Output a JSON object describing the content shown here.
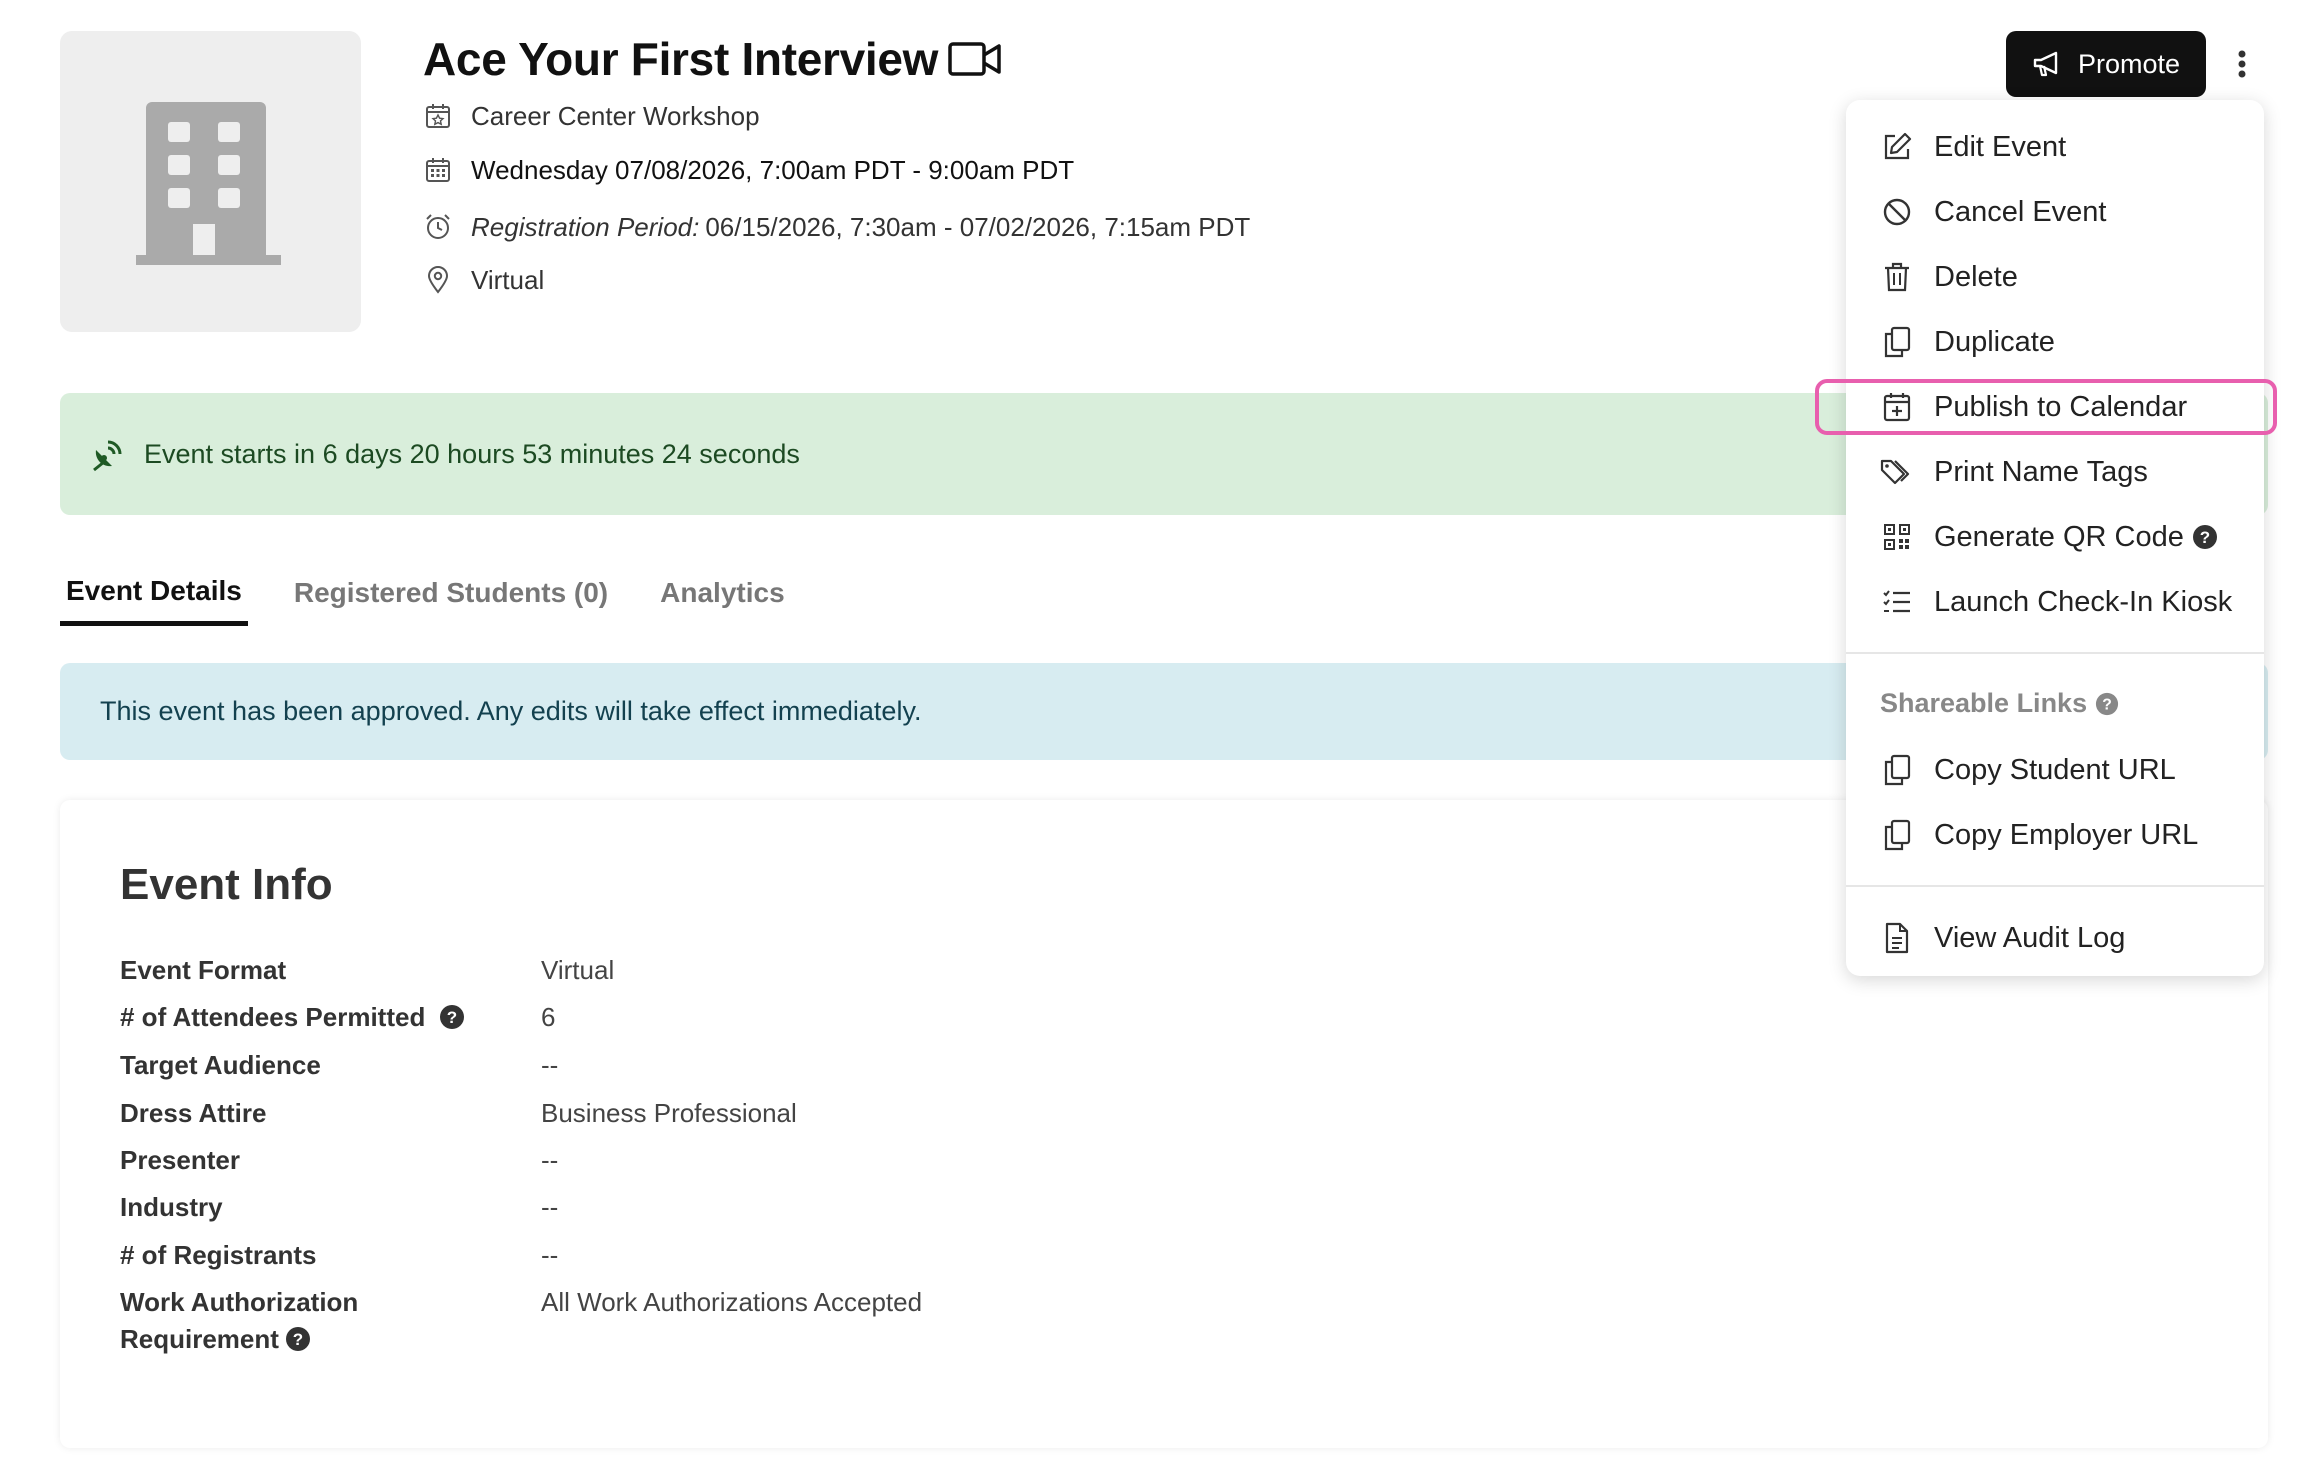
{
  "event": {
    "title": "Ace Your First Interview",
    "category": "Career Center Workshop",
    "datetime": "Wednesday 07/08/2026, 7:00am PDT - 9:00am PDT",
    "registration_label": "Registration Period:",
    "registration_value": "06/15/2026, 7:30am - 07/02/2026, 7:15am PDT",
    "location": "Virtual"
  },
  "header": {
    "promote_label": "Promote"
  },
  "countdown": {
    "text": "Event starts in 6 days 20 hours 53 minutes 24 seconds"
  },
  "tabs": [
    {
      "label": "Event Details",
      "active": true
    },
    {
      "label": "Registered Students (0)",
      "active": false
    },
    {
      "label": "Analytics",
      "active": false
    }
  ],
  "notice": {
    "text": "This event has been approved. Any edits will take effect immediately."
  },
  "info": {
    "title": "Event Info",
    "rows": [
      {
        "label": "Event Format",
        "value": "Virtual"
      },
      {
        "label": "# of Attendees Permitted",
        "value": "6"
      },
      {
        "label": "Target Audience",
        "value": "--"
      },
      {
        "label": "Dress Attire",
        "value": "Business Professional"
      },
      {
        "label": "Presenter",
        "value": "--"
      },
      {
        "label": "Industry",
        "value": "--"
      },
      {
        "label": "# of Registrants",
        "value": "--"
      },
      {
        "label": "Work Authorization",
        "label2": "Requirement",
        "value": "All Work Authorizations Accepted"
      }
    ]
  },
  "menu": {
    "items": [
      {
        "label": "Edit Event",
        "icon": "edit-icon"
      },
      {
        "label": "Cancel Event",
        "icon": "ban-icon"
      },
      {
        "label": "Delete",
        "icon": "trash-icon"
      },
      {
        "label": "Duplicate",
        "icon": "copy-icon"
      },
      {
        "label": "Publish to Calendar",
        "icon": "calendar-plus-icon"
      },
      {
        "label": "Print Name Tags",
        "icon": "tags-icon"
      },
      {
        "label": "Generate QR Code",
        "icon": "qr-code-icon"
      },
      {
        "label": "Launch Check-In Kiosk",
        "icon": "checklist-icon"
      }
    ],
    "shareable_title": "Shareable Links",
    "share_items": [
      {
        "label": "Copy Student URL",
        "icon": "copy-icon"
      },
      {
        "label": "Copy Employer URL",
        "icon": "copy-icon"
      }
    ],
    "audit_label": "View Audit Log",
    "highlight_color": "#e85fae"
  },
  "colors": {
    "success_bg": "#d9eedb",
    "info_bg": "#d7ecf1",
    "primary_button": "#111111"
  }
}
